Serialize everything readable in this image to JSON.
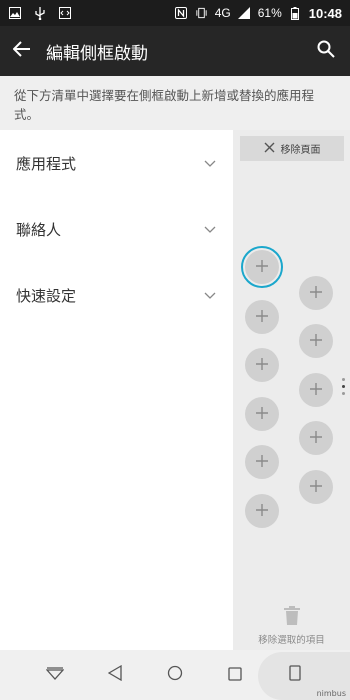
{
  "status_bar": {
    "battery": "61%",
    "network": "4G",
    "time": "10:48",
    "icons": [
      "image-icon",
      "usb-icon",
      "code-icon",
      "nfc-icon",
      "vibrate-icon",
      "signal-icon",
      "battery-icon"
    ]
  },
  "app_bar": {
    "title": "編輯側框啟動"
  },
  "description": "從下方清單中選擇要在側框啟動上新增或替換的應用程式。",
  "list": [
    {
      "label": "應用程式"
    },
    {
      "label": "聯絡人"
    },
    {
      "label": "快速設定"
    }
  ],
  "panel": {
    "remove_page_label": "移除頁面",
    "remove_selected_label": "移除選取的項目",
    "page_count": 2,
    "current_page": 1
  },
  "colors": {
    "status_bar": "#1c1c1c",
    "app_bar": "#262626",
    "accent": "#1aa4c9",
    "panel": "#ececec"
  },
  "watermark": {
    "text": "nimbus"
  }
}
